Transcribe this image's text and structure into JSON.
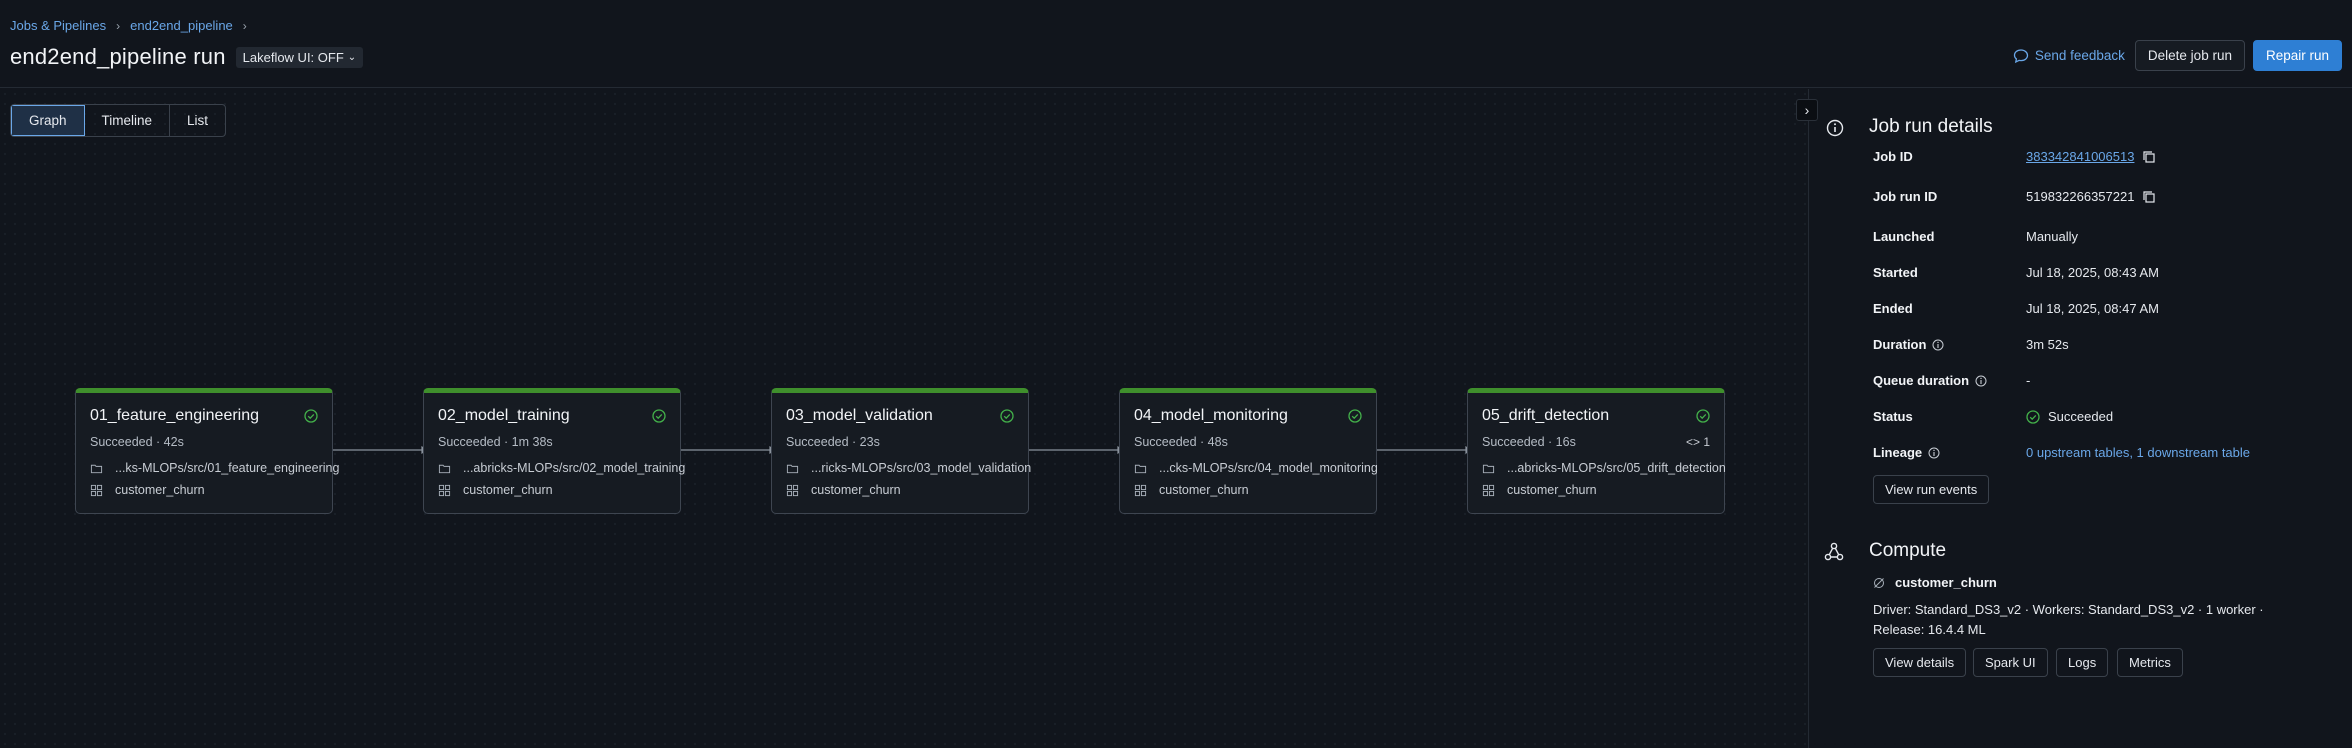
{
  "breadcrumb": {
    "root": "Jobs & Pipelines",
    "job": "end2end_pipeline"
  },
  "header": {
    "title": "end2end_pipeline run",
    "lakeflow_toggle": "Lakeflow UI: OFF",
    "send_feedback": "Send feedback",
    "delete_button": "Delete job run",
    "repair_button": "Repair run"
  },
  "view_tabs": [
    {
      "label": "Graph",
      "active": true
    },
    {
      "label": "Timeline",
      "active": false
    },
    {
      "label": "List",
      "active": false
    }
  ],
  "tasks": [
    {
      "name": "01_feature_engineering",
      "status": "Succeeded",
      "duration": "42s",
      "path": "...ks-MLOPs/src/01_feature_engineering",
      "cluster": "customer_churn",
      "badge": ""
    },
    {
      "name": "02_model_training",
      "status": "Succeeded",
      "duration": "1m 38s",
      "path": "...abricks-MLOPs/src/02_model_training",
      "cluster": "customer_churn",
      "badge": ""
    },
    {
      "name": "03_model_validation",
      "status": "Succeeded",
      "duration": "23s",
      "path": "...ricks-MLOPs/src/03_model_validation",
      "cluster": "customer_churn",
      "badge": ""
    },
    {
      "name": "04_model_monitoring",
      "status": "Succeeded",
      "duration": "48s",
      "path": "...cks-MLOPs/src/04_model_monitoring",
      "cluster": "customer_churn",
      "badge": ""
    },
    {
      "name": "05_drift_detection",
      "status": "Succeeded",
      "duration": "16s",
      "path": "...abricks-MLOPs/src/05_drift_detection",
      "cluster": "customer_churn",
      "badge": "<> 1"
    }
  ],
  "details": {
    "title": "Job run details",
    "job_id_label": "Job ID",
    "job_id": "383342841006513",
    "job_run_id_label": "Job run ID",
    "job_run_id": "519832266357221",
    "launched_label": "Launched",
    "launched": "Manually",
    "started_label": "Started",
    "started": "Jul 18, 2025, 08:43 AM",
    "ended_label": "Ended",
    "ended": "Jul 18, 2025, 08:47 AM",
    "duration_label": "Duration",
    "duration": "3m 52s",
    "queue_label": "Queue duration",
    "queue": "-",
    "status_label": "Status",
    "status": "Succeeded",
    "lineage_label": "Lineage",
    "lineage": "0 upstream tables, 1 downstream table",
    "view_run_events": "View run events"
  },
  "compute": {
    "title": "Compute",
    "cluster": "customer_churn",
    "description": "Driver: Standard_DS3_v2 · Workers: Standard_DS3_v2 · 1 worker · Release: 16.4.4 ML",
    "buttons": [
      "View details",
      "Spark UI",
      "Logs",
      "Metrics"
    ]
  },
  "colors": {
    "accent": "#2e7fd4",
    "link": "#6aa7e8",
    "success": "#3f8f2c",
    "success_icon": "#43b04a"
  }
}
